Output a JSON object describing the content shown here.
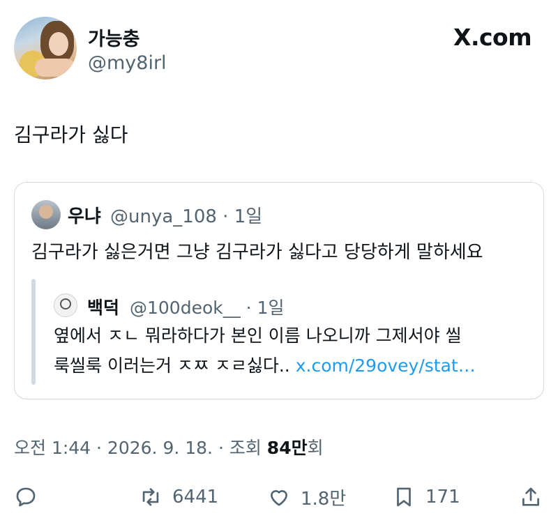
{
  "author": {
    "name": "가능충",
    "handle": "@my8irl"
  },
  "brand": "X.com",
  "tweet_text": "김구라가 싫다",
  "quoted": {
    "name": "우냐",
    "meta": "@unya_108 · 1일",
    "text": "김구라가 싫은거면 그냥 김구라가 싫다고 당당하게 말하세요",
    "inner": {
      "name": "백덕",
      "meta": "@100deok__ · 1일",
      "line1": "옆에서 ㅈㄴ 뭐라하다가 본인 이름 나오니까 그제서야 씰",
      "line2": "룩씰룩 이러는거 ㅈㅉ ㅈㄹ싫다..",
      "link": "x.com/29ovey/stat…"
    }
  },
  "footer": {
    "time": "오전 1:44 · 2026. 9. 18. · 조회 ",
    "views": "84만",
    "views_suffix": "회"
  },
  "actions": {
    "retweets": "6441",
    "likes": "1.8만",
    "bookmarks": "171"
  }
}
